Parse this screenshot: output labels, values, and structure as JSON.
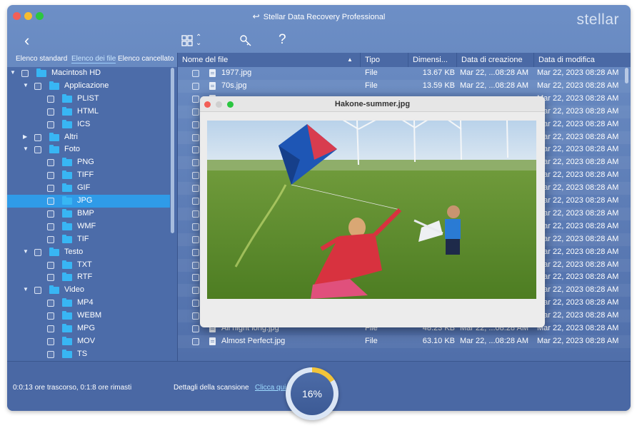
{
  "window": {
    "title": "Stellar Data Recovery Professional",
    "brand": "stellar"
  },
  "toolbar": {
    "back_icon": "chevron-left-icon",
    "view_icon": "grid-view-icon",
    "tools_icon": "key-icon",
    "help_label": "?"
  },
  "tabs": [
    "Elenco standard",
    "Elenco dei file",
    "Elenco cancellato"
  ],
  "active_tab": 1,
  "tree": [
    {
      "label": "Macintosh HD",
      "depth": 0,
      "expanded": true,
      "selected": false
    },
    {
      "label": "Applicazione",
      "depth": 1,
      "expanded": true,
      "selected": false
    },
    {
      "label": "PLIST",
      "depth": 2,
      "selected": false
    },
    {
      "label": "HTML",
      "depth": 2,
      "selected": false
    },
    {
      "label": "ICS",
      "depth": 2,
      "selected": false
    },
    {
      "label": "Altri",
      "depth": 1,
      "expanded": false,
      "selected": false
    },
    {
      "label": "Foto",
      "depth": 1,
      "expanded": true,
      "selected": false
    },
    {
      "label": "PNG",
      "depth": 2,
      "selected": false
    },
    {
      "label": "TIFF",
      "depth": 2,
      "selected": false
    },
    {
      "label": "GIF",
      "depth": 2,
      "selected": false
    },
    {
      "label": "JPG",
      "depth": 2,
      "selected": true
    },
    {
      "label": "BMP",
      "depth": 2,
      "selected": false
    },
    {
      "label": "WMF",
      "depth": 2,
      "selected": false
    },
    {
      "label": "TIF",
      "depth": 2,
      "selected": false
    },
    {
      "label": "Testo",
      "depth": 1,
      "expanded": true,
      "selected": false
    },
    {
      "label": "TXT",
      "depth": 2,
      "selected": false
    },
    {
      "label": "RTF",
      "depth": 2,
      "selected": false
    },
    {
      "label": "Video",
      "depth": 1,
      "expanded": true,
      "selected": false
    },
    {
      "label": "MP4",
      "depth": 2,
      "selected": false
    },
    {
      "label": "WEBM",
      "depth": 2,
      "selected": false
    },
    {
      "label": "MPG",
      "depth": 2,
      "selected": false
    },
    {
      "label": "MOV",
      "depth": 2,
      "selected": false
    },
    {
      "label": "TS",
      "depth": 2,
      "selected": false
    }
  ],
  "table": {
    "columns": [
      "Nome del file",
      "Tipo",
      "Dimensi...",
      "Data di creazione",
      "Data di modifica"
    ],
    "rows": [
      {
        "name": "1977.jpg",
        "type": "File",
        "size": "13.67 KB",
        "created": "Mar 22, ...08:28 AM",
        "modified": "Mar 22, 2023 08:28 AM"
      },
      {
        "name": "70s.jpg",
        "type": "File",
        "size": "13.59 KB",
        "created": "Mar 22, ...08:28 AM",
        "modified": "Mar 22, 2023 08:28 AM"
      },
      {
        "name": "",
        "type": "",
        "size": "",
        "created": "",
        "modified": "Mar 22, 2023 08:28 AM"
      },
      {
        "name": "",
        "type": "",
        "size": "",
        "created": "",
        "modified": "Mar 22, 2023 08:28 AM"
      },
      {
        "name": "",
        "type": "",
        "size": "",
        "created": "",
        "modified": "Mar 22, 2023 08:28 AM"
      },
      {
        "name": "",
        "type": "",
        "size": "",
        "created": "",
        "modified": "Mar 22, 2023 08:28 AM"
      },
      {
        "name": "",
        "type": "",
        "size": "",
        "created": "",
        "modified": "Mar 22, 2023 08:28 AM"
      },
      {
        "name": "",
        "type": "",
        "size": "",
        "created": "",
        "modified": "Mar 22, 2023 08:28 AM"
      },
      {
        "name": "",
        "type": "",
        "size": "",
        "created": "",
        "modified": "Mar 22, 2023 08:28 AM"
      },
      {
        "name": "",
        "type": "",
        "size": "",
        "created": "",
        "modified": "Mar 22, 2023 08:28 AM"
      },
      {
        "name": "",
        "type": "",
        "size": "",
        "created": "",
        "modified": "Mar 22, 2023 08:28 AM"
      },
      {
        "name": "",
        "type": "",
        "size": "",
        "created": "",
        "modified": "Mar 22, 2023 08:28 AM"
      },
      {
        "name": "",
        "type": "",
        "size": "",
        "created": "",
        "modified": "Mar 22, 2023 08:28 AM"
      },
      {
        "name": "",
        "type": "",
        "size": "",
        "created": "",
        "modified": "Mar 22, 2023 08:28 AM"
      },
      {
        "name": "",
        "type": "",
        "size": "",
        "created": "",
        "modified": "Mar 22, 2023 08:28 AM"
      },
      {
        "name": "",
        "type": "",
        "size": "",
        "created": "",
        "modified": "Mar 22, 2023 08:28 AM"
      },
      {
        "name": "",
        "type": "",
        "size": "",
        "created": "",
        "modified": "Mar 22, 2023 08:28 AM"
      },
      {
        "name": "",
        "type": "",
        "size": "",
        "created": "",
        "modified": "Mar 22, 2023 08:28 AM"
      },
      {
        "name": "",
        "type": "",
        "size": "",
        "created": "",
        "modified": "Mar 22, 2023 08:28 AM"
      },
      {
        "name": "Alzoona.jpg",
        "type": "File",
        "size": "13.02 KB",
        "created": "Mar 22, ...08:28 AM",
        "modified": "Mar 22, 2023 08:28 AM"
      },
      {
        "name": "All night long.jpg",
        "type": "File",
        "size": "48.23 KB",
        "created": "Mar 22, ...08:28 AM",
        "modified": "Mar 22, 2023 08:28 AM"
      },
      {
        "name": "Almost Perfect.jpg",
        "type": "File",
        "size": "63.10 KB",
        "created": "Mar 22, ...08:28 AM",
        "modified": "Mar 22, 2023 08:28 AM"
      }
    ]
  },
  "footer": {
    "elapsed": "0:0:13 ore trascorso, 0:1:8 ore rimasti",
    "details_label": "Dettagli della scansione",
    "details_link": "Clicca qui",
    "progress_label": "16%",
    "progress_fraction": 0.16
  },
  "preview": {
    "title": "Hakone-summer.jpg"
  },
  "colors": {
    "selection": "#2f9be8",
    "folder": "#38b6f4",
    "progress": "#f2c43a",
    "link": "#9edbff"
  }
}
